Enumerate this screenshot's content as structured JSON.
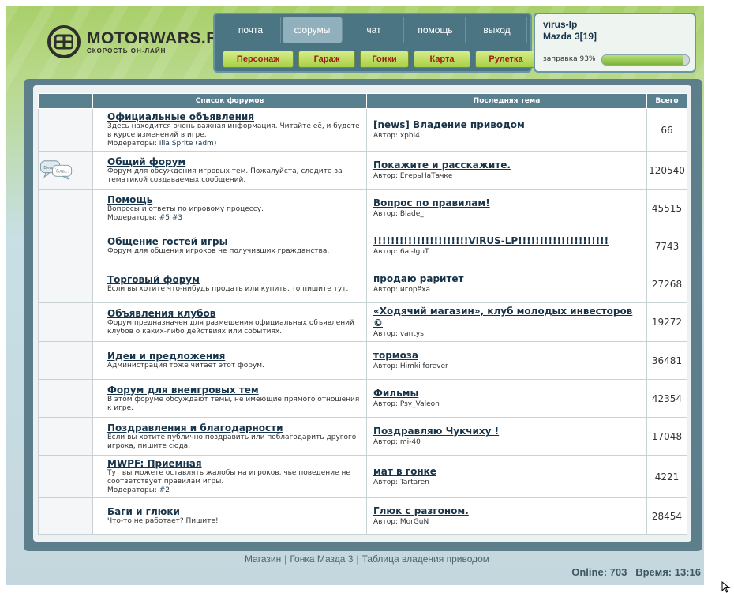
{
  "logo": {
    "title": "MOTORWARS.RU",
    "subtitle": "СКОРОСТЬ ОН-ЛАЙН"
  },
  "topnav": [
    {
      "label": "почта",
      "active": false
    },
    {
      "label": "форумы",
      "active": true
    },
    {
      "label": "чат",
      "active": false
    },
    {
      "label": "помощь",
      "active": false
    },
    {
      "label": "выход",
      "active": false
    }
  ],
  "subnav": [
    "Персонаж",
    "Гараж",
    "Гонки",
    "Карта",
    "Рулетка"
  ],
  "user": {
    "name": "virus-lp",
    "car": "Mazda 3[19]",
    "fuel_label": "заправка 93%",
    "fuel_fraction": 0.93
  },
  "table": {
    "headers": {
      "forums": "Список форумов",
      "last": "Последняя тема",
      "total": "Всего"
    },
    "rows": [
      {
        "title": "Официальные объявления",
        "desc": "Здесь находится очень важная информация. Читайте её, и будете в курсе изменений в игре.",
        "mods_label": "Модераторы:",
        "mods": "Ilia Sprite (adm)",
        "last_title": "[news] Владение приводом",
        "author_label": "Автор:",
        "author": "xpbl4",
        "total": "66"
      },
      {
        "title": "Общий форум",
        "desc": "Форум для обсуждения игровых тем. Пожалуйста, следите за тематикой создаваемых сообщений.",
        "mods_label": "",
        "mods": "",
        "last_title": "Покажите и расскажите.",
        "author_label": "Автор:",
        "author": "ЕгерьНаТачке",
        "total": "120540",
        "icon": "chat-bubbles-icon",
        "icon_text1": "Бла...",
        "icon_text2": "Бла..."
      },
      {
        "title": "Помощь",
        "desc": "Вопросы и ответы по игровому процессу.",
        "mods_label": "Модераторы:",
        "mods": "#5 #3",
        "last_title": "Вопрос по правилам!",
        "author_label": "Автор:",
        "author": "Blade_",
        "total": "45515"
      },
      {
        "title": "Общение гостей игры",
        "desc": "Форум для общения игроков не получивших гражданства.",
        "mods_label": "",
        "mods": "",
        "last_title": "!!!!!!!!!!!!!!!!!!!!!!VIRUS-LP!!!!!!!!!!!!!!!!!!!!!",
        "author_label": "Автор:",
        "author": "6aI-IguT",
        "total": "7743"
      },
      {
        "title": "Торговый форум",
        "desc": "Если вы хотите что-нибудь продать или купить, то пишите тут.",
        "mods_label": "",
        "mods": "",
        "last_title": "продаю раритет",
        "author_label": "Автор:",
        "author": "игорёха",
        "total": "27268"
      },
      {
        "title": "Объявления клубов",
        "desc": "Форум предназначен для размещения официальных объявлений клубов о каких-либо действиях или событиях.",
        "mods_label": "",
        "mods": "",
        "last_title": "«Ходячий магазин», клуб молодых инвесторов ©",
        "author_label": "Автор:",
        "author": "vantys",
        "total": "19272"
      },
      {
        "title": "Идеи и предложения",
        "desc": "Администрация тоже читает этот форум.",
        "mods_label": "",
        "mods": "",
        "last_title": "тормоза",
        "author_label": "Автор:",
        "author": "Himki forever",
        "total": "36481"
      },
      {
        "title": "Форум для внеигровых тем",
        "desc": "В этом форуме обсуждают темы, не имеющие прямого отношения к игре.",
        "mods_label": "",
        "mods": "",
        "last_title": "Фильмы",
        "author_label": "Автор:",
        "author": "Psy_Valeon",
        "total": "42354"
      },
      {
        "title": "Поздравления и благодарности",
        "desc": "Если вы хотите публично поздравить или поблагодарить другого игрока, пишите сюда.",
        "mods_label": "",
        "mods": "",
        "last_title": "Поздравляю Чукчиху !",
        "author_label": "Автор:",
        "author": "mi-40",
        "total": "17048"
      },
      {
        "title": "MWPF: Приемная",
        "desc": "Тут вы можете оставлять жалобы на игроков, чье поведение не соответствует правилам игры.",
        "mods_label": "Модераторы:",
        "mods": "#2",
        "last_title": "мат в гонке",
        "author_label": "Автор:",
        "author": "Tartaren",
        "total": "4221"
      },
      {
        "title": "Баги и глюки",
        "desc": "Что-то не работает? Пишите!",
        "mods_label": "",
        "mods": "",
        "last_title": "Глюк с разгоном.",
        "author_label": "Автор:",
        "author": "MorGuN",
        "total": "28454"
      }
    ]
  },
  "footer": {
    "links": [
      "Магазин",
      "Гонка Мазда 3",
      "Таблица владения приводом"
    ],
    "separator": "|",
    "online_label": "Online:",
    "online": "703",
    "time_label": "Время:",
    "time": "13:16"
  },
  "colors": {
    "header": "#58808e",
    "accent_green": "#a8d046",
    "nav_red": "#9a1e14",
    "link": "#17344a"
  }
}
